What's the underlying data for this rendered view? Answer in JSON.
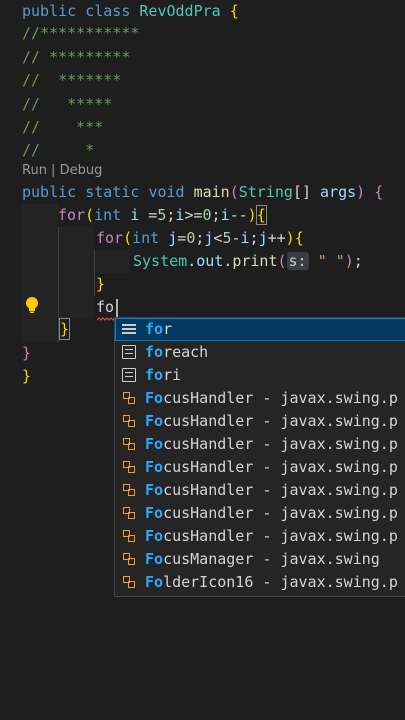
{
  "code": {
    "l1": {
      "kw1": "public",
      "kw2": "class",
      "cls": "RevOddPra",
      "brace": "{"
    },
    "l2": "//***********",
    "l3": "// *********",
    "l4": "//  *******",
    "l5": "//   *****",
    "l6": "//    ***",
    "l7": "//     *",
    "codelens": "Run | Debug",
    "l8": {
      "kw1": "public",
      "kw2": "static",
      "kw3": "void",
      "fn": "main",
      "p1": "(",
      "ty": "String",
      "arr": "[]",
      "var": "args",
      "p2": ")",
      "brace": "{"
    },
    "l9": {
      "ctl": "for",
      "p1": "(",
      "ty": "int",
      "var": "i",
      "rest1": " =",
      "n1": "5",
      "rest2": ";",
      "v2": "i",
      "rest3": ">=",
      "n2": "0",
      "rest4": ";",
      "v3": "i",
      "rest5": "--",
      "p2": ")",
      "brace": "{"
    },
    "l10": {
      "ctl": "for",
      "p1": "(",
      "ty": "int",
      "var": "j",
      "rest1": "=",
      "n1": "0",
      "rest2": ";",
      "v2": "j",
      "rest3": "<",
      "n2": "5",
      "rest4": "-",
      "v3": "i",
      "rest5": ";",
      "v4": "j",
      "rest6": "++",
      "p2": ")",
      "brace": "{"
    },
    "l11": {
      "cls": "System",
      "dot1": ".",
      "field": "out",
      "dot2": ".",
      "fn": "print",
      "p1": "(",
      "hint": "s:",
      "str": "\" \"",
      "p2": ")",
      "semi": ";"
    },
    "l12": "}",
    "l13_typed": "fo",
    "l14": "}",
    "l15": "}",
    "l16": "}"
  },
  "suggestions": [
    {
      "match": "fo",
      "rest": "r",
      "detail": "",
      "icon": "keyword-icon"
    },
    {
      "match": "fo",
      "rest": "reach",
      "detail": "",
      "icon": "snippet-icon"
    },
    {
      "match": "fo",
      "rest": "ri",
      "detail": "",
      "icon": "snippet-icon"
    },
    {
      "match": "Fo",
      "rest": "cusHandler",
      "detail": " - javax.swing.p",
      "icon": "class-icon"
    },
    {
      "match": "Fo",
      "rest": "cusHandler",
      "detail": " - javax.swing.p",
      "icon": "class-icon"
    },
    {
      "match": "Fo",
      "rest": "cusHandler",
      "detail": " - javax.swing.p",
      "icon": "class-icon"
    },
    {
      "match": "Fo",
      "rest": "cusHandler",
      "detail": " - javax.swing.p",
      "icon": "class-icon"
    },
    {
      "match": "Fo",
      "rest": "cusHandler",
      "detail": " - javax.swing.p",
      "icon": "class-icon"
    },
    {
      "match": "Fo",
      "rest": "cusHandler",
      "detail": " - javax.swing.p",
      "icon": "class-icon"
    },
    {
      "match": "Fo",
      "rest": "cusHandler",
      "detail": " - javax.swing.p",
      "icon": "class-icon"
    },
    {
      "match": "Fo",
      "rest": "cusManager",
      "detail": " - javax.swing",
      "icon": "class-icon"
    },
    {
      "match": "Fo",
      "rest": "lderIcon16",
      "detail": " - javax.swing.p",
      "icon": "class-icon"
    }
  ],
  "colors": {
    "background": "#1e1e1e",
    "keyword": "#569cd6",
    "control": "#c586c0",
    "type": "#4ec9b0",
    "function": "#dcdcaa",
    "comment": "#6a9955",
    "match_highlight": "#2aaaff",
    "selection": "#04395e"
  }
}
